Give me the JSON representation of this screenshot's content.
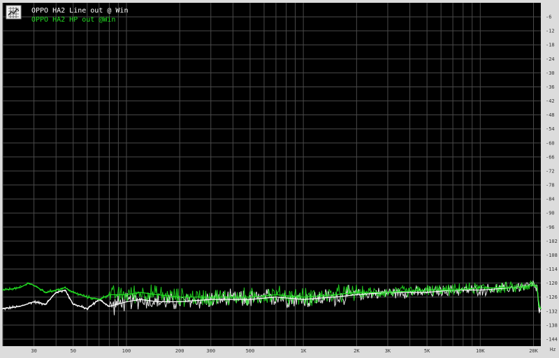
{
  "chart_data": {
    "type": "line",
    "title": "",
    "xlabel": "",
    "ylabel": "",
    "x_scale": "log",
    "y_unit_note": "dB",
    "xlim": [
      20,
      22000
    ],
    "ylim": [
      -147,
      0
    ],
    "grid": true,
    "legend_placement": "top-left",
    "x_ticks": [
      {
        "value": 30,
        "label": "30"
      },
      {
        "value": 50,
        "label": "50"
      },
      {
        "value": 100,
        "label": "100"
      },
      {
        "value": 200,
        "label": "200"
      },
      {
        "value": 300,
        "label": "300"
      },
      {
        "value": 500,
        "label": "500"
      },
      {
        "value": 1000,
        "label": "1K"
      },
      {
        "value": 2000,
        "label": "2K"
      },
      {
        "value": 3000,
        "label": "3K"
      },
      {
        "value": 5000,
        "label": "5K"
      },
      {
        "value": 10000,
        "label": "10K"
      },
      {
        "value": 20000,
        "label": "20K"
      }
    ],
    "x_unit_label": "Hz",
    "y_ticks": [
      -6,
      -12,
      -18,
      -24,
      -30,
      -36,
      -42,
      -48,
      -54,
      -60,
      -66,
      -72,
      -78,
      -84,
      -90,
      -96,
      -102,
      -108,
      -114,
      -120,
      -126,
      -132,
      -138,
      -144
    ],
    "y_tick_labels": [
      "-6",
      "-12",
      "-18",
      "-24",
      "-30",
      "-36",
      "-42",
      "-48",
      "-54",
      "-60",
      "-66",
      "-72",
      "-78",
      "-84",
      "-90",
      "-96",
      "-102",
      "-108",
      "-114",
      "-120",
      "-126",
      "-132",
      "-138",
      "-144"
    ],
    "series": [
      {
        "name": "OPPO HA2 Line out @ Win",
        "color": "#ffffff",
        "points": [
          [
            20,
            -131
          ],
          [
            25,
            -130
          ],
          [
            30,
            -128
          ],
          [
            35,
            -129
          ],
          [
            40,
            -124
          ],
          [
            45,
            -123
          ],
          [
            50,
            -129
          ],
          [
            60,
            -131
          ],
          [
            70,
            -127
          ],
          [
            80,
            -130
          ],
          [
            100,
            -128
          ],
          [
            120,
            -127
          ],
          [
            150,
            -128
          ],
          [
            200,
            -128
          ],
          [
            300,
            -127
          ],
          [
            500,
            -127
          ],
          [
            700,
            -126
          ],
          [
            1000,
            -127
          ],
          [
            1500,
            -126
          ],
          [
            2000,
            -125
          ],
          [
            3000,
            -124
          ],
          [
            5000,
            -124
          ],
          [
            7000,
            -123
          ],
          [
            10000,
            -123
          ],
          [
            15000,
            -122
          ],
          [
            20000,
            -121
          ],
          [
            21000,
            -122
          ],
          [
            21500,
            -132
          ],
          [
            22000,
            -132
          ]
        ]
      },
      {
        "name": "OPPO HA2 HP out @Win",
        "color": "#22dd22",
        "points": [
          [
            20,
            -123
          ],
          [
            25,
            -122
          ],
          [
            28,
            -120
          ],
          [
            30,
            -121
          ],
          [
            35,
            -124
          ],
          [
            40,
            -123
          ],
          [
            45,
            -122
          ],
          [
            50,
            -124
          ],
          [
            60,
            -126
          ],
          [
            70,
            -127
          ],
          [
            80,
            -125
          ],
          [
            100,
            -125
          ],
          [
            120,
            -124
          ],
          [
            150,
            -125
          ],
          [
            200,
            -126
          ],
          [
            300,
            -126
          ],
          [
            500,
            -126
          ],
          [
            700,
            -125
          ],
          [
            1000,
            -126
          ],
          [
            1500,
            -125
          ],
          [
            2000,
            -124
          ],
          [
            3000,
            -124
          ],
          [
            5000,
            -123
          ],
          [
            7000,
            -123
          ],
          [
            10000,
            -122
          ],
          [
            15000,
            -122
          ],
          [
            20000,
            -121
          ],
          [
            21000,
            -122
          ],
          [
            21500,
            -130
          ],
          [
            22000,
            -131
          ]
        ]
      }
    ]
  },
  "app_icon": "chart-app-icon"
}
